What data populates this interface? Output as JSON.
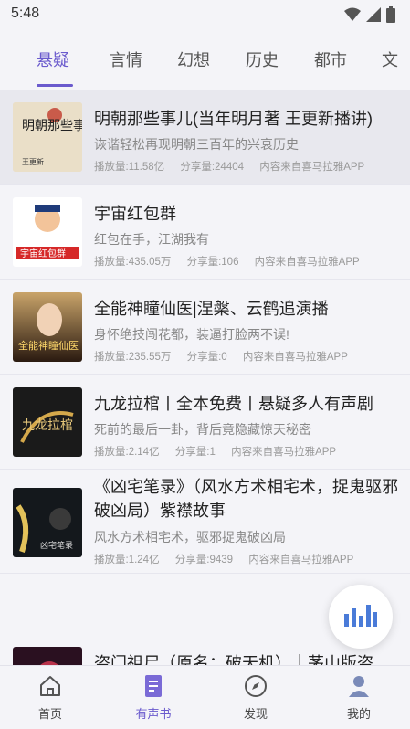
{
  "status": {
    "time": "5:48"
  },
  "tabs": [
    {
      "label": "悬疑",
      "active": true
    },
    {
      "label": "言情"
    },
    {
      "label": "幻想"
    },
    {
      "label": "历史"
    },
    {
      "label": "都市"
    },
    {
      "label": "文"
    }
  ],
  "items": [
    {
      "title": "明朝那些事儿(当年明月著 王更新播讲)",
      "desc": "诙谐轻松再现明朝三百年的兴衰历史",
      "plays": "播放量:11.58亿",
      "shares": "分享量:24404",
      "source": "内容来自喜马拉雅APP",
      "cover_text": "明朝那些事儿",
      "cover_sub": "王更新"
    },
    {
      "title": "宇宙红包群",
      "desc": "红包在手，江湖我有",
      "plays": "播放量:435.05万",
      "shares": "分享量:106",
      "source": "内容来自喜马拉雅APP",
      "cover_text": "宇宙红包群"
    },
    {
      "title": "全能神瞳仙医|涅槃、云鹤追演播",
      "desc": "身怀绝技闯花都，装逼打脸两不误!",
      "plays": "播放量:235.55万",
      "shares": "分享量:0",
      "source": "内容来自喜马拉雅APP",
      "cover_text": "全能神瞳仙医"
    },
    {
      "title": "九龙拉棺丨全本免费丨悬疑多人有声剧",
      "desc": "死前的最后一卦，背后竟隐藏惊天秘密",
      "plays": "播放量:2.14亿",
      "shares": "分享量:1",
      "source": "内容来自喜马拉雅APP",
      "cover_text": "九龙拉棺"
    },
    {
      "title": "《凶宅笔录》（风水方术相宅术，捉鬼驱邪破凶局）紫襟故事",
      "desc": "风水方术相宅术，驱邪捉鬼破凶局",
      "plays": "播放量:1.24亿",
      "shares": "分享量:9439",
      "source": "内容来自喜马拉雅APP",
      "cover_text": "凶宅笔录"
    },
    {
      "title": "盗门祖尸（原名：破天机）｜茅山版盗",
      "desc": "",
      "plays": "",
      "shares": "",
      "source": "",
      "cover_text": ""
    }
  ],
  "nav": [
    {
      "label": "首页",
      "icon": "home-icon"
    },
    {
      "label": "有声书",
      "icon": "audiobook-icon",
      "active": true
    },
    {
      "label": "发现",
      "icon": "compass-icon"
    },
    {
      "label": "我的",
      "icon": "profile-icon"
    }
  ],
  "colors": {
    "accent": "#6a5acd",
    "fab_bars": "#4a7bd8"
  }
}
